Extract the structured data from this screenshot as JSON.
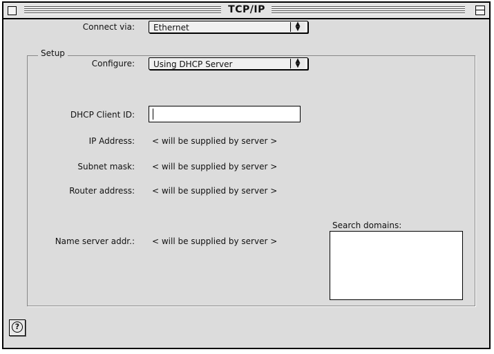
{
  "window": {
    "title": "TCP/IP"
  },
  "connect_via": {
    "label": "Connect via:",
    "value": "Ethernet"
  },
  "setup": {
    "title": "Setup",
    "configure": {
      "label": "Configure:",
      "value": "Using DHCP Server"
    },
    "dhcp_client_id": {
      "label": "DHCP Client ID:",
      "value": ""
    },
    "ip_address": {
      "label": "IP Address:",
      "value": "< will be supplied by server >"
    },
    "subnet_mask": {
      "label": "Subnet mask:",
      "value": "< will be supplied by server >"
    },
    "router_address": {
      "label": "Router address:",
      "value": "< will be supplied by server >"
    },
    "name_server": {
      "label": "Name server addr.:",
      "value": "< will be supplied by server >"
    },
    "search_domains": {
      "label": "Search domains:",
      "value": ""
    }
  },
  "help": {
    "icon": "help-icon",
    "glyph": "?"
  }
}
